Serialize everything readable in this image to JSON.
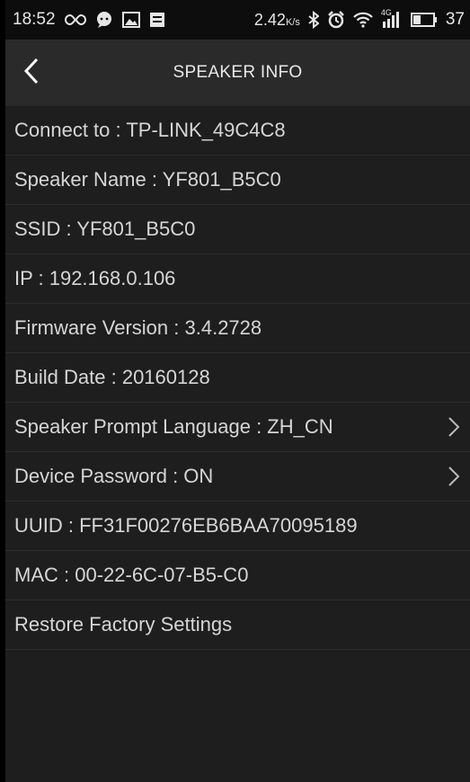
{
  "status_bar": {
    "time": "18:52",
    "speed_value": "2.42",
    "speed_unit": "K/s",
    "network_label": "4G",
    "battery": "37",
    "icons": [
      "infinity-icon",
      "chat-icon",
      "image-icon",
      "notes-icon",
      "bluetooth-icon",
      "alarm-icon",
      "wifi-icon",
      "signal-icon",
      "battery-icon"
    ]
  },
  "header": {
    "title": "SPEAKER INFO",
    "back_icon": "chevron-left-icon"
  },
  "rows": [
    {
      "label": "Connect to : TP-LINK_49C4C8",
      "chevron": false
    },
    {
      "label": "Speaker Name : YF801_B5C0",
      "chevron": false
    },
    {
      "label": "SSID : YF801_B5C0",
      "chevron": false
    },
    {
      "label": "IP : 192.168.0.106",
      "chevron": false
    },
    {
      "label": "Firmware Version : 3.4.2728",
      "chevron": false
    },
    {
      "label": "Build Date : 20160128",
      "chevron": false
    },
    {
      "label": "Speaker Prompt Language : ZH_CN",
      "chevron": true
    },
    {
      "label": "Device Password : ON",
      "chevron": true
    },
    {
      "label": "UUID : FF31F00276EB6BAA70095189",
      "chevron": false
    },
    {
      "label": "MAC : 00-22-6C-07-B5-C0",
      "chevron": false
    },
    {
      "label": "Restore Factory Settings",
      "chevron": false
    }
  ],
  "colors": {
    "background": "#1e1e1e",
    "header": "#2a2a2a",
    "status_bar": "#0d0d0d",
    "text": "#d6d6d6"
  }
}
